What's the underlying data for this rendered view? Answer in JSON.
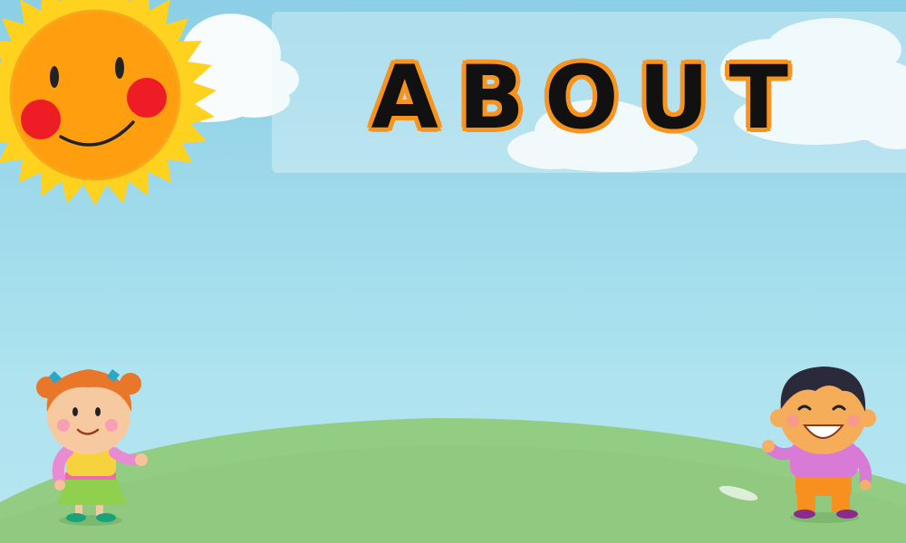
{
  "page": {
    "title": "ABOUT"
  },
  "colors": {
    "sky": "#a2dcec",
    "title_fill": "#111111",
    "title_outline": "#f7941d",
    "sun_rays": "#ffd21f",
    "sun_face": "#ff9f0f",
    "cheeks": "#ee1c24",
    "grass": "#93cc83"
  },
  "icons": {
    "sun": "smiling-sun",
    "girl": "girl-character",
    "boy": "boy-character"
  }
}
